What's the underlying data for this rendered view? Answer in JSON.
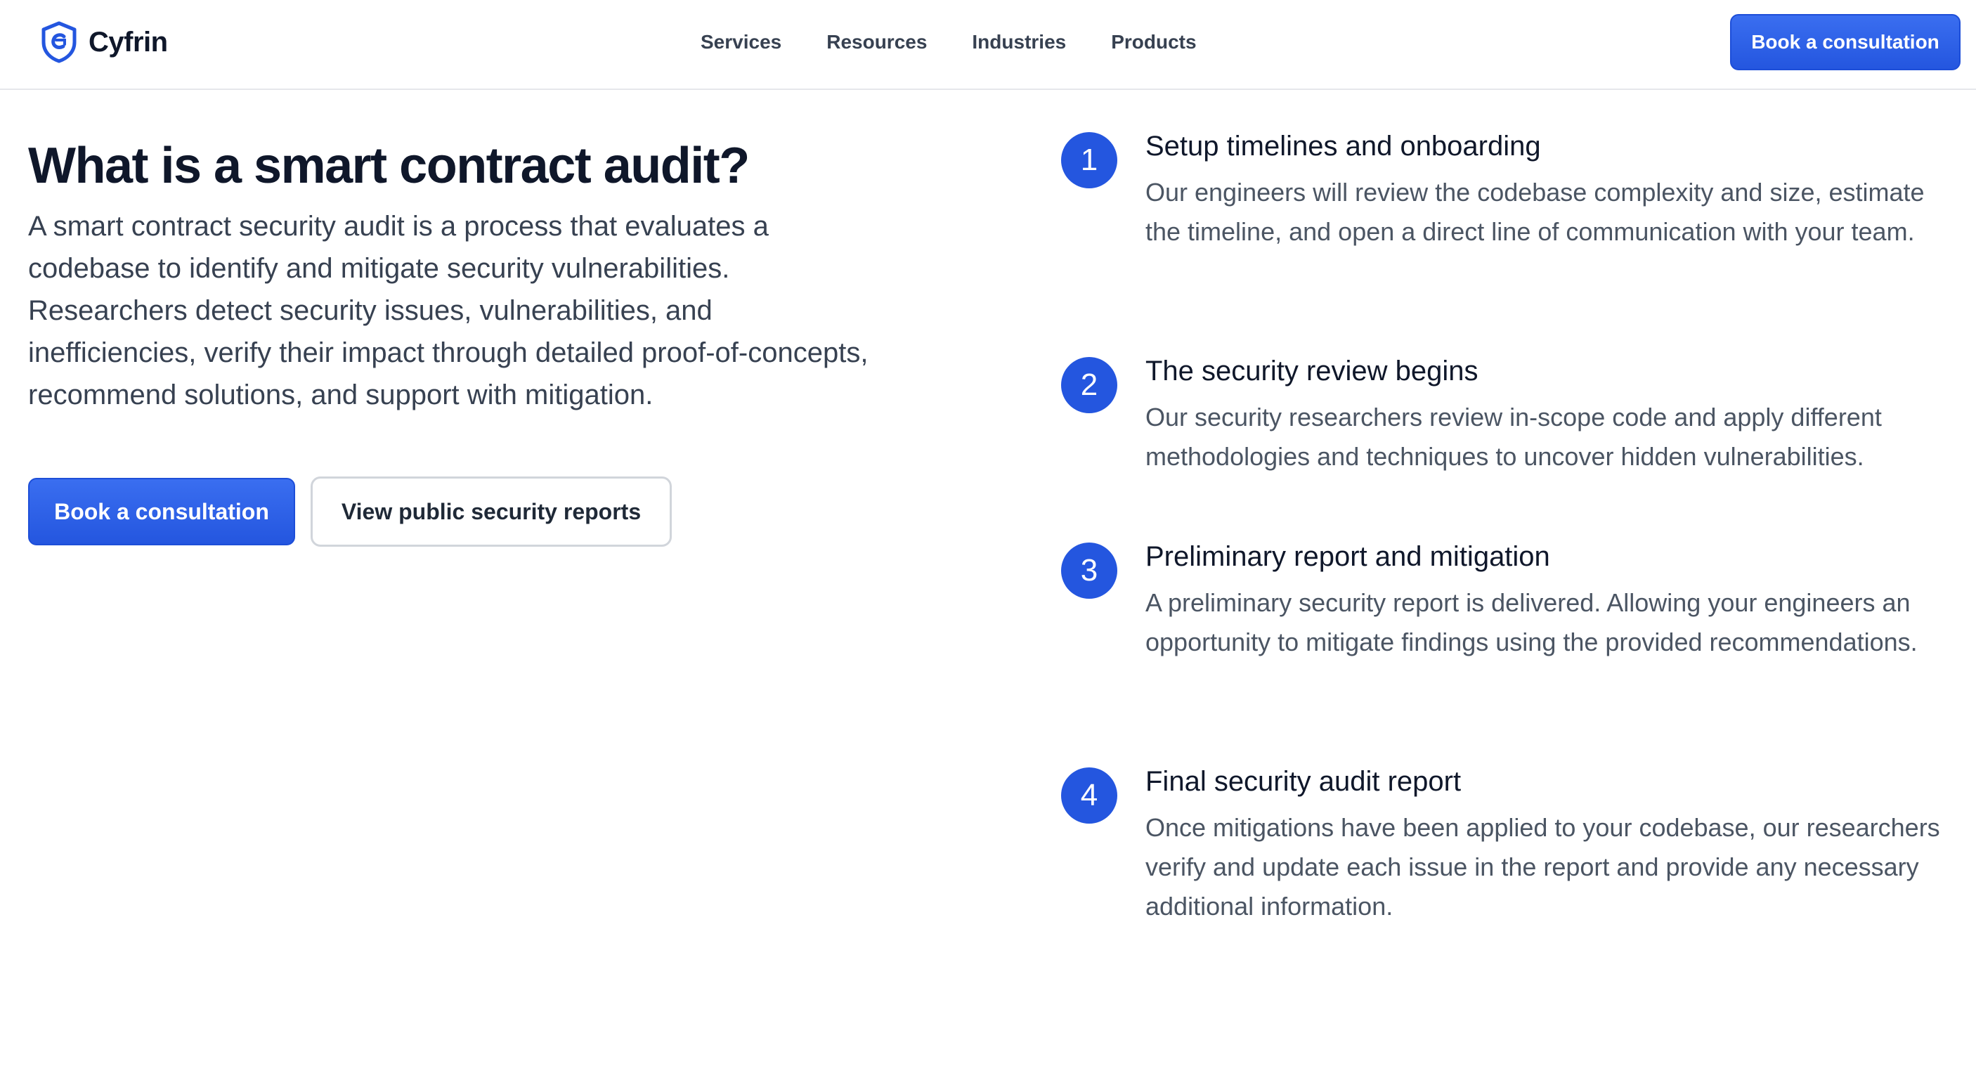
{
  "header": {
    "brand": "Cyfrin",
    "nav": [
      "Services",
      "Resources",
      "Industries",
      "Products"
    ],
    "cta_label": "Book a consultation"
  },
  "hero": {
    "title": "What is a smart contract audit?",
    "description": "A smart contract security audit is a process that evaluates a codebase to identify and mitigate security vulnerabilities. Researchers detect security issues, vulnerabilities, and inefficiencies, verify their impact through detailed proof-of-concepts, recommend solutions, and support with mitigation.",
    "primary_cta": "Book a consultation",
    "secondary_cta": "View public security reports"
  },
  "steps": [
    {
      "number": "1",
      "title": "Setup timelines and onboarding",
      "description": "Our engineers will review the codebase complexity and size, estimate the timeline, and open a direct line of communication with your team."
    },
    {
      "number": "2",
      "title": "The security review begins",
      "description": "Our security researchers review in-scope code and apply different methodologies and techniques to uncover hidden vulnerabilities."
    },
    {
      "number": "3",
      "title": "Preliminary report and mitigation",
      "description": "A preliminary security report is delivered. Allowing your engineers an opportunity to mitigate findings using the provided recommendations."
    },
    {
      "number": "4",
      "title": "Final security audit report",
      "description": "Once mitigations have been applied to your codebase, our researchers verify and update each issue in the report and provide any necessary additional information."
    }
  ],
  "colors": {
    "accent": "#2456df",
    "heading": "#0f172a",
    "body_text": "#4b5563"
  },
  "icons": {
    "brand_logo": "shield-logo-icon"
  }
}
